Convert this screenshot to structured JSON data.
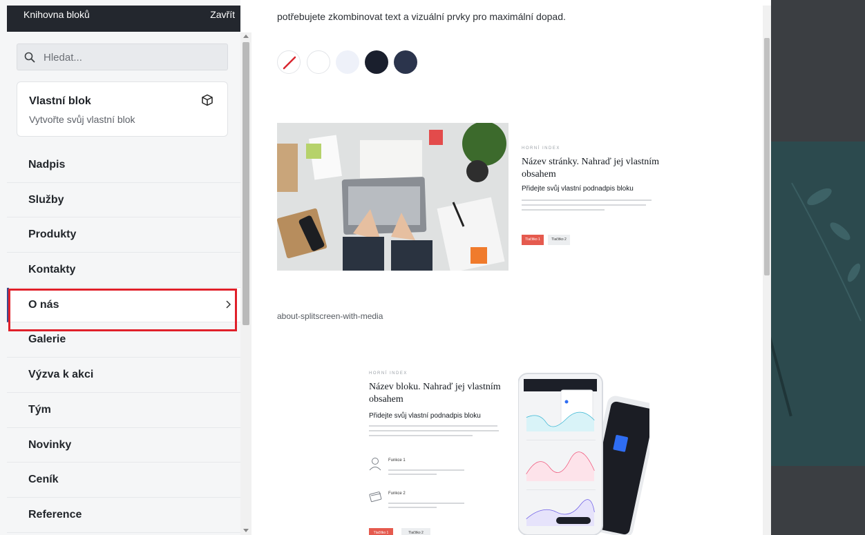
{
  "sidebar": {
    "title": "Knihovna bloků",
    "close_label": "Zavřít",
    "search": {
      "placeholder": "Hledat..."
    },
    "custom_block": {
      "title": "Vlastní blok",
      "subtitle": "Vytvořte svůj vlastní blok",
      "icon": "cube-icon"
    },
    "categories": [
      {
        "label": "Nadpis"
      },
      {
        "label": "Služby"
      },
      {
        "label": "Produkty"
      },
      {
        "label": "Kontakty"
      },
      {
        "label": "O nás",
        "active": true
      },
      {
        "label": "Galerie"
      },
      {
        "label": "Výzva k akci"
      },
      {
        "label": "Tým"
      },
      {
        "label": "Novinky"
      },
      {
        "label": "Ceník"
      },
      {
        "label": "Reference"
      }
    ]
  },
  "main": {
    "intro_text": "potřebujete zkombinovat text a vizuální prvky pro maximální dopad.",
    "swatches": [
      "none",
      "#ffffff",
      "#eef1f9",
      "#1a1f2d",
      "#2b344c"
    ],
    "block1": {
      "eyebrow": "HORNÍ INDEX",
      "heading": "Název stránky. Nahraď jej vlastním obsahem",
      "subheading": "Přidejte svůj vlastní podnadpis bloku",
      "button1": "Tlačítko 1",
      "button2": "Tlačítko 2"
    },
    "block2_name": "about-splitscreen-with-media",
    "block2": {
      "eyebrow": "HORNÍ INDEX",
      "heading": "Název bloku. Nahraď jej vlastním obsahem",
      "subheading": "Přidejte svůj vlastní podnadpis bloku",
      "feature1": "Funkce 1",
      "feature2": "Funkce 2",
      "button1": "Tlačítko 1",
      "button2": "Tlačítko 2"
    }
  },
  "colors": {
    "header_bg": "#23272e",
    "highlight": "#e0202a",
    "active_marker": "#3b4a8f",
    "button_red": "#e55a4e"
  }
}
